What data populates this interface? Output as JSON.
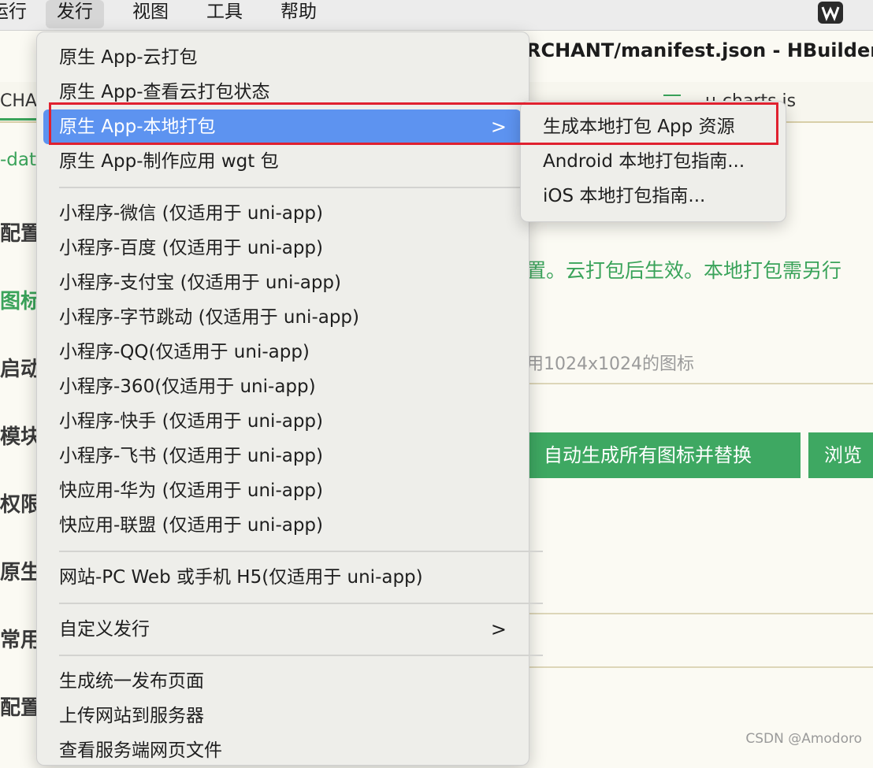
{
  "menubar": {
    "items": [
      "运行",
      "发行",
      "视图",
      "工具",
      "帮助"
    ],
    "active": "发行",
    "partial_left": "运行"
  },
  "editor": {
    "title": "RCHANT/manifest.json - HBuilder",
    "tab_left": "CHAI",
    "tab_right": "u-charts.js",
    "side_labels": [
      "-dat",
      "配置",
      "图标",
      "启动",
      "模块",
      "权限",
      "原生",
      "常用",
      "配置"
    ],
    "hint_green": "置。云打包后生效。本地打包需另行",
    "hint_gray": "用1024x1024的图标",
    "buttons": [
      "自动生成所有图标并替换",
      "浏览"
    ]
  },
  "menu": {
    "items": [
      {
        "label": "原生 App-云打包"
      },
      {
        "label": "原生 App-查看云打包状态"
      },
      {
        "label": "原生 App-本地打包",
        "highlighted": true,
        "has_submenu": true
      },
      {
        "label": "原生 App-制作应用 wgt 包"
      },
      {
        "label": "小程序-微信 (仅适用于 uni-app)"
      },
      {
        "label": "小程序-百度 (仅适用于 uni-app)"
      },
      {
        "label": "小程序-支付宝 (仅适用于 uni-app)"
      },
      {
        "label": "小程序-字节跳动 (仅适用于 uni-app)"
      },
      {
        "label": "小程序-QQ(仅适用于 uni-app)"
      },
      {
        "label": "小程序-360(仅适用于 uni-app)"
      },
      {
        "label": "小程序-快手 (仅适用于 uni-app)"
      },
      {
        "label": "小程序-飞书 (仅适用于 uni-app)"
      },
      {
        "label": "快应用-华为 (仅适用于 uni-app)"
      },
      {
        "label": "快应用-联盟 (仅适用于 uni-app)"
      },
      {
        "label": "网站-PC Web 或手机 H5(仅适用于 uni-app)"
      },
      {
        "label": "自定义发行",
        "has_submenu": true
      },
      {
        "label": "生成统一发布页面"
      },
      {
        "label": "上传网站到服务器"
      },
      {
        "label": "查看服务端网页文件"
      }
    ],
    "submenu_chevron": ">"
  },
  "submenu": {
    "items": [
      "生成本地打包 App 资源",
      "Android 本地打包指南...",
      "iOS 本地打包指南..."
    ]
  },
  "watermark": "CSDN @Amodoro",
  "colors": {
    "highlight": "#5d93f0",
    "accent_green": "#3ea862",
    "annotation_red": "#e0212f"
  }
}
